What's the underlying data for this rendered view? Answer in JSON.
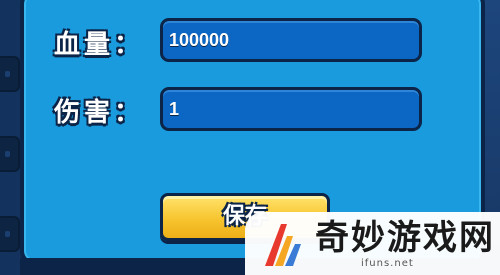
{
  "form": {
    "hp_label": "血量：",
    "hp_value": "100000",
    "damage_label": "伤害：",
    "damage_value": "1",
    "save_label": "保存"
  },
  "watermark": {
    "brand": "奇妙游戏网",
    "url": "ifuns.net"
  },
  "colors": {
    "panel": "#199bde",
    "field": "#0b66c4",
    "outline": "#0b2448",
    "button": "#f7c530"
  }
}
